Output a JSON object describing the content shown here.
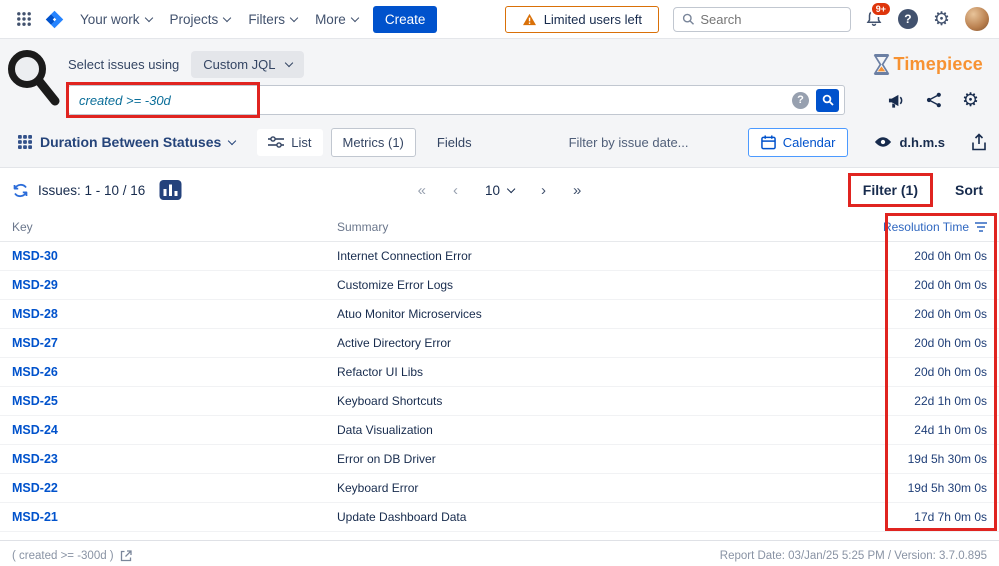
{
  "topnav": {
    "menu": [
      "Your work",
      "Projects",
      "Filters",
      "More"
    ],
    "create": "Create",
    "warning": "Limited users left",
    "search_placeholder": "Search",
    "badge": "9+",
    "help_glyph": "?",
    "gear_glyph": "⚙"
  },
  "query": {
    "select_label": "Select issues using",
    "mode": "Custom JQL",
    "jql": "created >= -30d",
    "help_glyph": "?"
  },
  "brand": {
    "name": "Timepiece"
  },
  "toolbar": {
    "view": "Duration Between Statuses",
    "list": "List",
    "metrics": "Metrics (1)",
    "fields": "Fields",
    "date_filter": "Filter by issue date...",
    "calendar": "Calendar",
    "format": "d.h.m.s",
    "gear_glyph": "⚙"
  },
  "issues_bar": {
    "count": "Issues: 1 - 10 / 16",
    "first": "«",
    "prev": "‹",
    "page_size": "10",
    "next": "›",
    "last": "»",
    "filter": "Filter (1)",
    "sort": "Sort"
  },
  "table": {
    "columns": {
      "key": "Key",
      "summary": "Summary",
      "resolution": "Resolution Time"
    },
    "rows": [
      {
        "key": "MSD-30",
        "summary": "Internet Connection Error",
        "resolution": "20d 0h 0m 0s"
      },
      {
        "key": "MSD-29",
        "summary": "Customize Error Logs",
        "resolution": "20d 0h 0m 0s"
      },
      {
        "key": "MSD-28",
        "summary": "Atuo Monitor Microservices",
        "resolution": "20d 0h 0m 0s"
      },
      {
        "key": "MSD-27",
        "summary": "Active Directory Error",
        "resolution": "20d 0h 0m 0s"
      },
      {
        "key": "MSD-26",
        "summary": "Refactor UI Libs",
        "resolution": "20d 0h 0m 0s"
      },
      {
        "key": "MSD-25",
        "summary": "Keyboard Shortcuts",
        "resolution": "22d 1h 0m 0s"
      },
      {
        "key": "MSD-24",
        "summary": "Data Visualization",
        "resolution": "24d 1h 0m 0s"
      },
      {
        "key": "MSD-23",
        "summary": "Error on DB Driver",
        "resolution": "19d 5h 30m 0s"
      },
      {
        "key": "MSD-22",
        "summary": "Keyboard Error",
        "resolution": "19d 5h 30m 0s"
      },
      {
        "key": "MSD-21",
        "summary": "Update Dashboard Data",
        "resolution": "17d 7h 0m 0s"
      }
    ]
  },
  "footer": {
    "left": "( created >= -300d )",
    "right": "Report Date: 03/Jan/25 5:25 PM / Version: 3.7.0.895"
  },
  "colors": {
    "accent_blue": "#0052CC",
    "highlight_red": "#e02420",
    "warning_orange": "#D97008",
    "brand_orange": "#F79232"
  }
}
